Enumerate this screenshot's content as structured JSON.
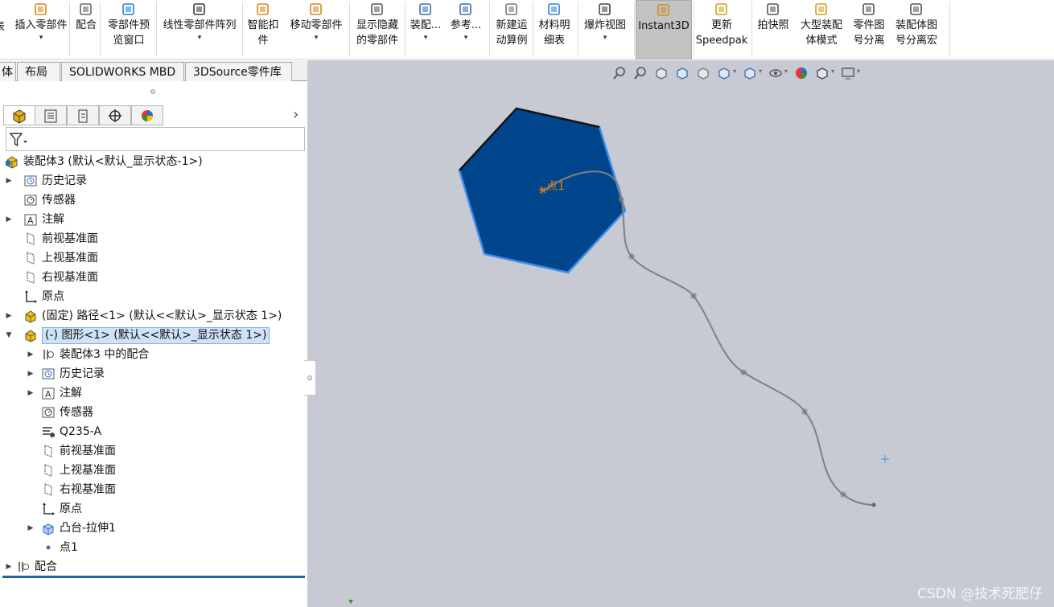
{
  "ribbon": {
    "items": [
      {
        "label": "插入零部件",
        "icon": "insert-component-icon",
        "dropdown": true
      },
      {
        "label": "配合",
        "icon": "mate-icon"
      },
      {
        "label": "零部件预\n览窗口",
        "icon": "preview-window-icon"
      },
      {
        "label": "线性零部件阵列",
        "icon": "linear-pattern-icon",
        "dropdown": true
      },
      {
        "label": "智能扣\n件",
        "icon": "smart-fastener-icon"
      },
      {
        "label": "移动零部件",
        "icon": "move-component-icon",
        "dropdown": true
      },
      {
        "label": "显示隐藏\n的零部件",
        "icon": "show-hidden-icon"
      },
      {
        "label": "装配...",
        "icon": "assembly-feature-icon",
        "dropdown": true
      },
      {
        "label": "参考...",
        "icon": "reference-geometry-icon",
        "dropdown": true
      },
      {
        "label": "新建运\n动算例",
        "icon": "motion-study-icon"
      },
      {
        "label": "材料明\n细表",
        "icon": "bom-icon"
      },
      {
        "label": "爆炸视图",
        "icon": "exploded-view-icon",
        "dropdown": true
      },
      {
        "label": "Instant3D",
        "icon": "instant3d-icon",
        "active": true
      },
      {
        "label": "更新\nSpeedpak",
        "icon": "speedpak-icon"
      },
      {
        "label": "拍快照",
        "icon": "camera-icon"
      },
      {
        "label": "大型装配\n体模式",
        "icon": "large-assembly-icon"
      },
      {
        "label": "零件图\n号分离",
        "icon": "part-number-icon"
      },
      {
        "label": "装配体图\n号分离宏",
        "icon": "assembly-number-macro-icon"
      }
    ],
    "partial_left_label": "表"
  },
  "tabs": [
    {
      "label": "体"
    },
    {
      "label": "布局"
    },
    {
      "label": "SOLIDWORKS MBD"
    },
    {
      "label": "3DSource零件库"
    }
  ],
  "panel_tabs": [
    {
      "name": "featuremanager-tab",
      "icon": "featuremanager-icon"
    },
    {
      "name": "propertymanager-tab",
      "icon": "propertymanager-icon"
    },
    {
      "name": "configurationmanager-tab",
      "icon": "configurationmanager-icon"
    },
    {
      "name": "dimxpert-tab",
      "icon": "dimxpert-icon"
    },
    {
      "name": "display-manager-tab",
      "icon": "display-manager-icon"
    }
  ],
  "panel_more": "›",
  "filter_icon": "filter-icon",
  "tree": [
    {
      "label": "装配体3  (默认<默认_显示状态-1>)",
      "icon": "assembly",
      "level": 0,
      "expander": ""
    },
    {
      "label": "历史记录",
      "icon": "history",
      "level": 1,
      "expander": "▶"
    },
    {
      "label": "传感器",
      "icon": "sensor",
      "level": 1,
      "expander": ""
    },
    {
      "label": "注解",
      "icon": "annotation",
      "level": 1,
      "expander": "▶"
    },
    {
      "label": "前视基准面",
      "icon": "plane",
      "level": 1,
      "expander": ""
    },
    {
      "label": "上视基准面",
      "icon": "plane",
      "level": 1,
      "expander": ""
    },
    {
      "label": "右视基准面",
      "icon": "plane",
      "level": 1,
      "expander": ""
    },
    {
      "label": "原点",
      "icon": "origin",
      "level": 1,
      "expander": ""
    },
    {
      "label": "(固定) 路径<1> (默认<<默认>_显示状态 1>)",
      "icon": "part",
      "level": 1,
      "expander": "▶"
    },
    {
      "label": "(-) 图形<1> (默认<<默认>_显示状态 1>)",
      "icon": "part",
      "level": 1,
      "expander": "▼",
      "selected": true
    },
    {
      "label": "装配体3 中的配合",
      "icon": "mates",
      "level": 2,
      "expander": "▶"
    },
    {
      "label": "历史记录",
      "icon": "history",
      "level": 2,
      "expander": "▶"
    },
    {
      "label": "注解",
      "icon": "annotation",
      "level": 2,
      "expander": "▶"
    },
    {
      "label": "传感器",
      "icon": "sensor",
      "level": 2,
      "expander": ""
    },
    {
      "label": "Q235-A",
      "icon": "material",
      "level": 2,
      "expander": ""
    },
    {
      "label": "前视基准面",
      "icon": "plane",
      "level": 2,
      "expander": ""
    },
    {
      "label": "上视基准面",
      "icon": "plane",
      "level": 2,
      "expander": ""
    },
    {
      "label": "右视基准面",
      "icon": "plane",
      "level": 2,
      "expander": ""
    },
    {
      "label": "原点",
      "icon": "origin",
      "level": 2,
      "expander": ""
    },
    {
      "label": "凸台-拉伸1",
      "icon": "extrude",
      "level": 2,
      "expander": "▶"
    },
    {
      "label": "点1",
      "icon": "point",
      "level": 2,
      "expander": ""
    },
    {
      "label": "配合",
      "icon": "mates",
      "level": 0,
      "expander": "▶"
    }
  ],
  "viewport": {
    "point_label": "点1",
    "hexagon_color": "#01458d",
    "edge_color": "#3c8fe8",
    "path_color": "#808080",
    "background": "#c7c9d3",
    "view_toolbar": [
      {
        "name": "zoom-to-fit-icon"
      },
      {
        "name": "zoom-to-area-icon"
      },
      {
        "name": "previous-view-icon"
      },
      {
        "name": "section-view-icon"
      },
      {
        "name": "dynamic-annotation-icon"
      },
      {
        "name": "view-orientation-icon",
        "dropdown": true
      },
      {
        "name": "display-style-icon",
        "dropdown": true
      },
      {
        "name": "hide-show-items-icon",
        "dropdown": true
      },
      {
        "name": "edit-appearance-icon"
      },
      {
        "name": "apply-scene-icon",
        "dropdown": true
      },
      {
        "name": "view-settings-icon",
        "dropdown": true
      }
    ]
  },
  "watermark": "CSDN @技术死肥仔"
}
